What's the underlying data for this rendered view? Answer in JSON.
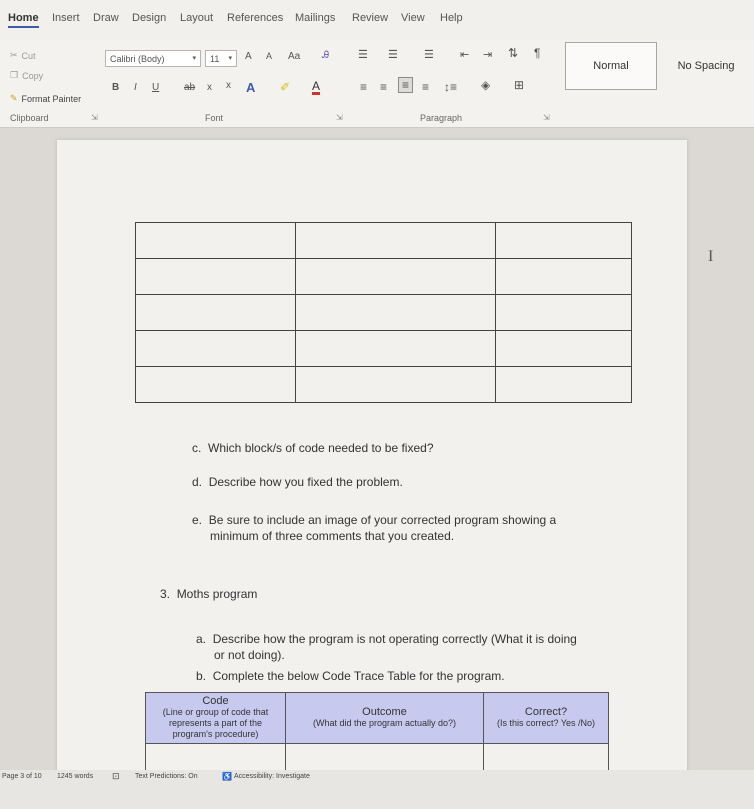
{
  "ribbon_tabs": [
    "Home",
    "Insert",
    "Draw",
    "Design",
    "Layout",
    "References",
    "Mailings",
    "Review",
    "View",
    "Help"
  ],
  "clipboard": {
    "cut": "Cut",
    "copy": "Copy",
    "format_painter": "Format Painter",
    "label": "Clipboard"
  },
  "font": {
    "name": "Calibri (Body)",
    "size": "11",
    "label": "Font",
    "grow": "A",
    "shrink": "A",
    "case": "Aa",
    "bold": "B",
    "italic": "I",
    "underline": "U",
    "strike": "ab",
    "subscript": "x",
    "superscript": "x",
    "color_letter": "A"
  },
  "paragraph": {
    "label": "Paragraph",
    "pilcrow": "¶"
  },
  "styles": {
    "normal": "Normal",
    "no_spacing": "No Spacing"
  },
  "document": {
    "q_c": {
      "letter": "c.",
      "text": "Which block/s of code needed to be fixed?"
    },
    "q_d": {
      "letter": "d.",
      "text": "Describe how you fixed the problem."
    },
    "q_e": {
      "letter": "e.",
      "line1": "Be sure to include an image of your corrected program showing a",
      "line2": "minimum of three comments that you created."
    },
    "q_3": {
      "number": "3.",
      "text": "Moths program"
    },
    "q_3a": {
      "letter": "a.",
      "line1": "Describe how the program is not operating correctly (What it is doing",
      "line2": "or not doing)."
    },
    "q_3b": {
      "letter": "b.",
      "text": "Complete the below Code Trace Table for the program."
    },
    "trace_table": {
      "code_title": "Code",
      "code_sub1": "(Line or group of code that",
      "code_sub2": "represents a part of the",
      "code_sub3": "program's procedure)",
      "outcome_title": "Outcome",
      "outcome_sub": "(What did the program actually do?)",
      "correct_title": "Correct?",
      "correct_sub": "(Is this correct? Yes /No)"
    }
  },
  "status_bar": {
    "page": "Page 3 of 10",
    "words": "1245 words",
    "predictions": "Text Predictions: On",
    "accessibility": "Accessibility: Investigate"
  },
  "colors": {
    "table_header": "#c8c9ee",
    "active_tab_underline": "#3a5fa8"
  }
}
